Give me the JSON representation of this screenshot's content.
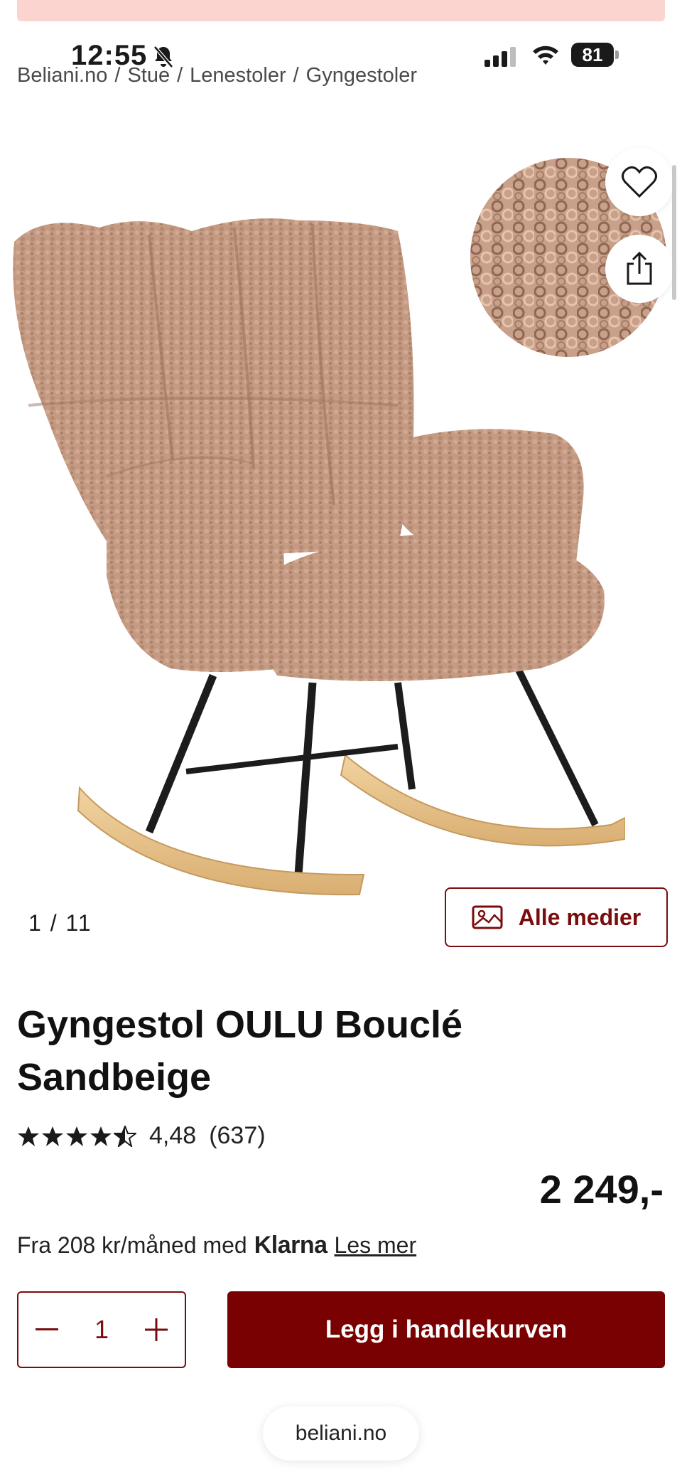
{
  "status_bar": {
    "time": "12:55",
    "battery": "81"
  },
  "breadcrumb": {
    "items": [
      "Beliani.no",
      "Stue",
      "Lenestoler",
      "Gyngestoler"
    ],
    "separator": "/"
  },
  "gallery": {
    "counter_current": "1",
    "counter_sep": "/",
    "counter_total": "11",
    "all_media_label": "Alle medier"
  },
  "product": {
    "title_line1": "Gyngestol OULU Bouclé",
    "title_line2": "Sandbeige",
    "rating_value": "4,48",
    "rating_count": "(637)",
    "rating_stars": 4.48,
    "price": "2 249,-"
  },
  "finance": {
    "text": "Fra 208 kr/måned med",
    "provider": "Klarna",
    "link": "Les mer"
  },
  "cart": {
    "quantity": "1",
    "add_label": "Legg i handlekurven"
  },
  "browser": {
    "url": "beliani.no"
  },
  "colors": {
    "brand": "#7a0101",
    "banner": "#fbd4cf",
    "fabric": "#c49a82"
  }
}
